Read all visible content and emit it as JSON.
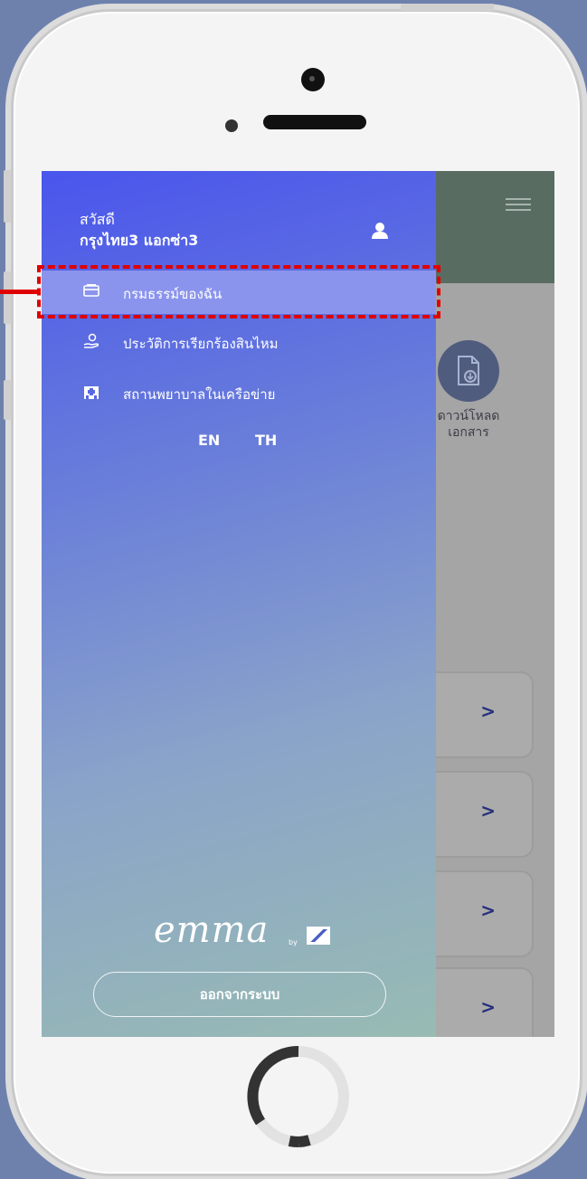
{
  "drawer": {
    "greeting": "สวัสดี",
    "user_name": "กรุงไทย3 แอกซ่า3",
    "menu": [
      {
        "label": "กรมธรรม์ของฉัน",
        "icon": "card-icon",
        "active": true
      },
      {
        "label": "ประวัติการเรียกร้องสินไหม",
        "icon": "hand-coin-icon",
        "active": false
      },
      {
        "label": "สถานพยาบาลในเครือข่าย",
        "icon": "hospital-icon",
        "active": false
      }
    ],
    "languages": [
      "EN",
      "TH"
    ],
    "logo_text": "emma",
    "logo_by": "by",
    "logout_label": "ออกจากระบบ"
  },
  "background_app": {
    "download_label_line1": "ดาวน์โหลด",
    "download_label_line2": "เอกสาร",
    "chevron": ">"
  },
  "colors": {
    "drawer_top": "#4a55ec",
    "drawer_bottom": "#98bbb3",
    "active_item": "#8b94ec",
    "highlight": "#e10000"
  }
}
